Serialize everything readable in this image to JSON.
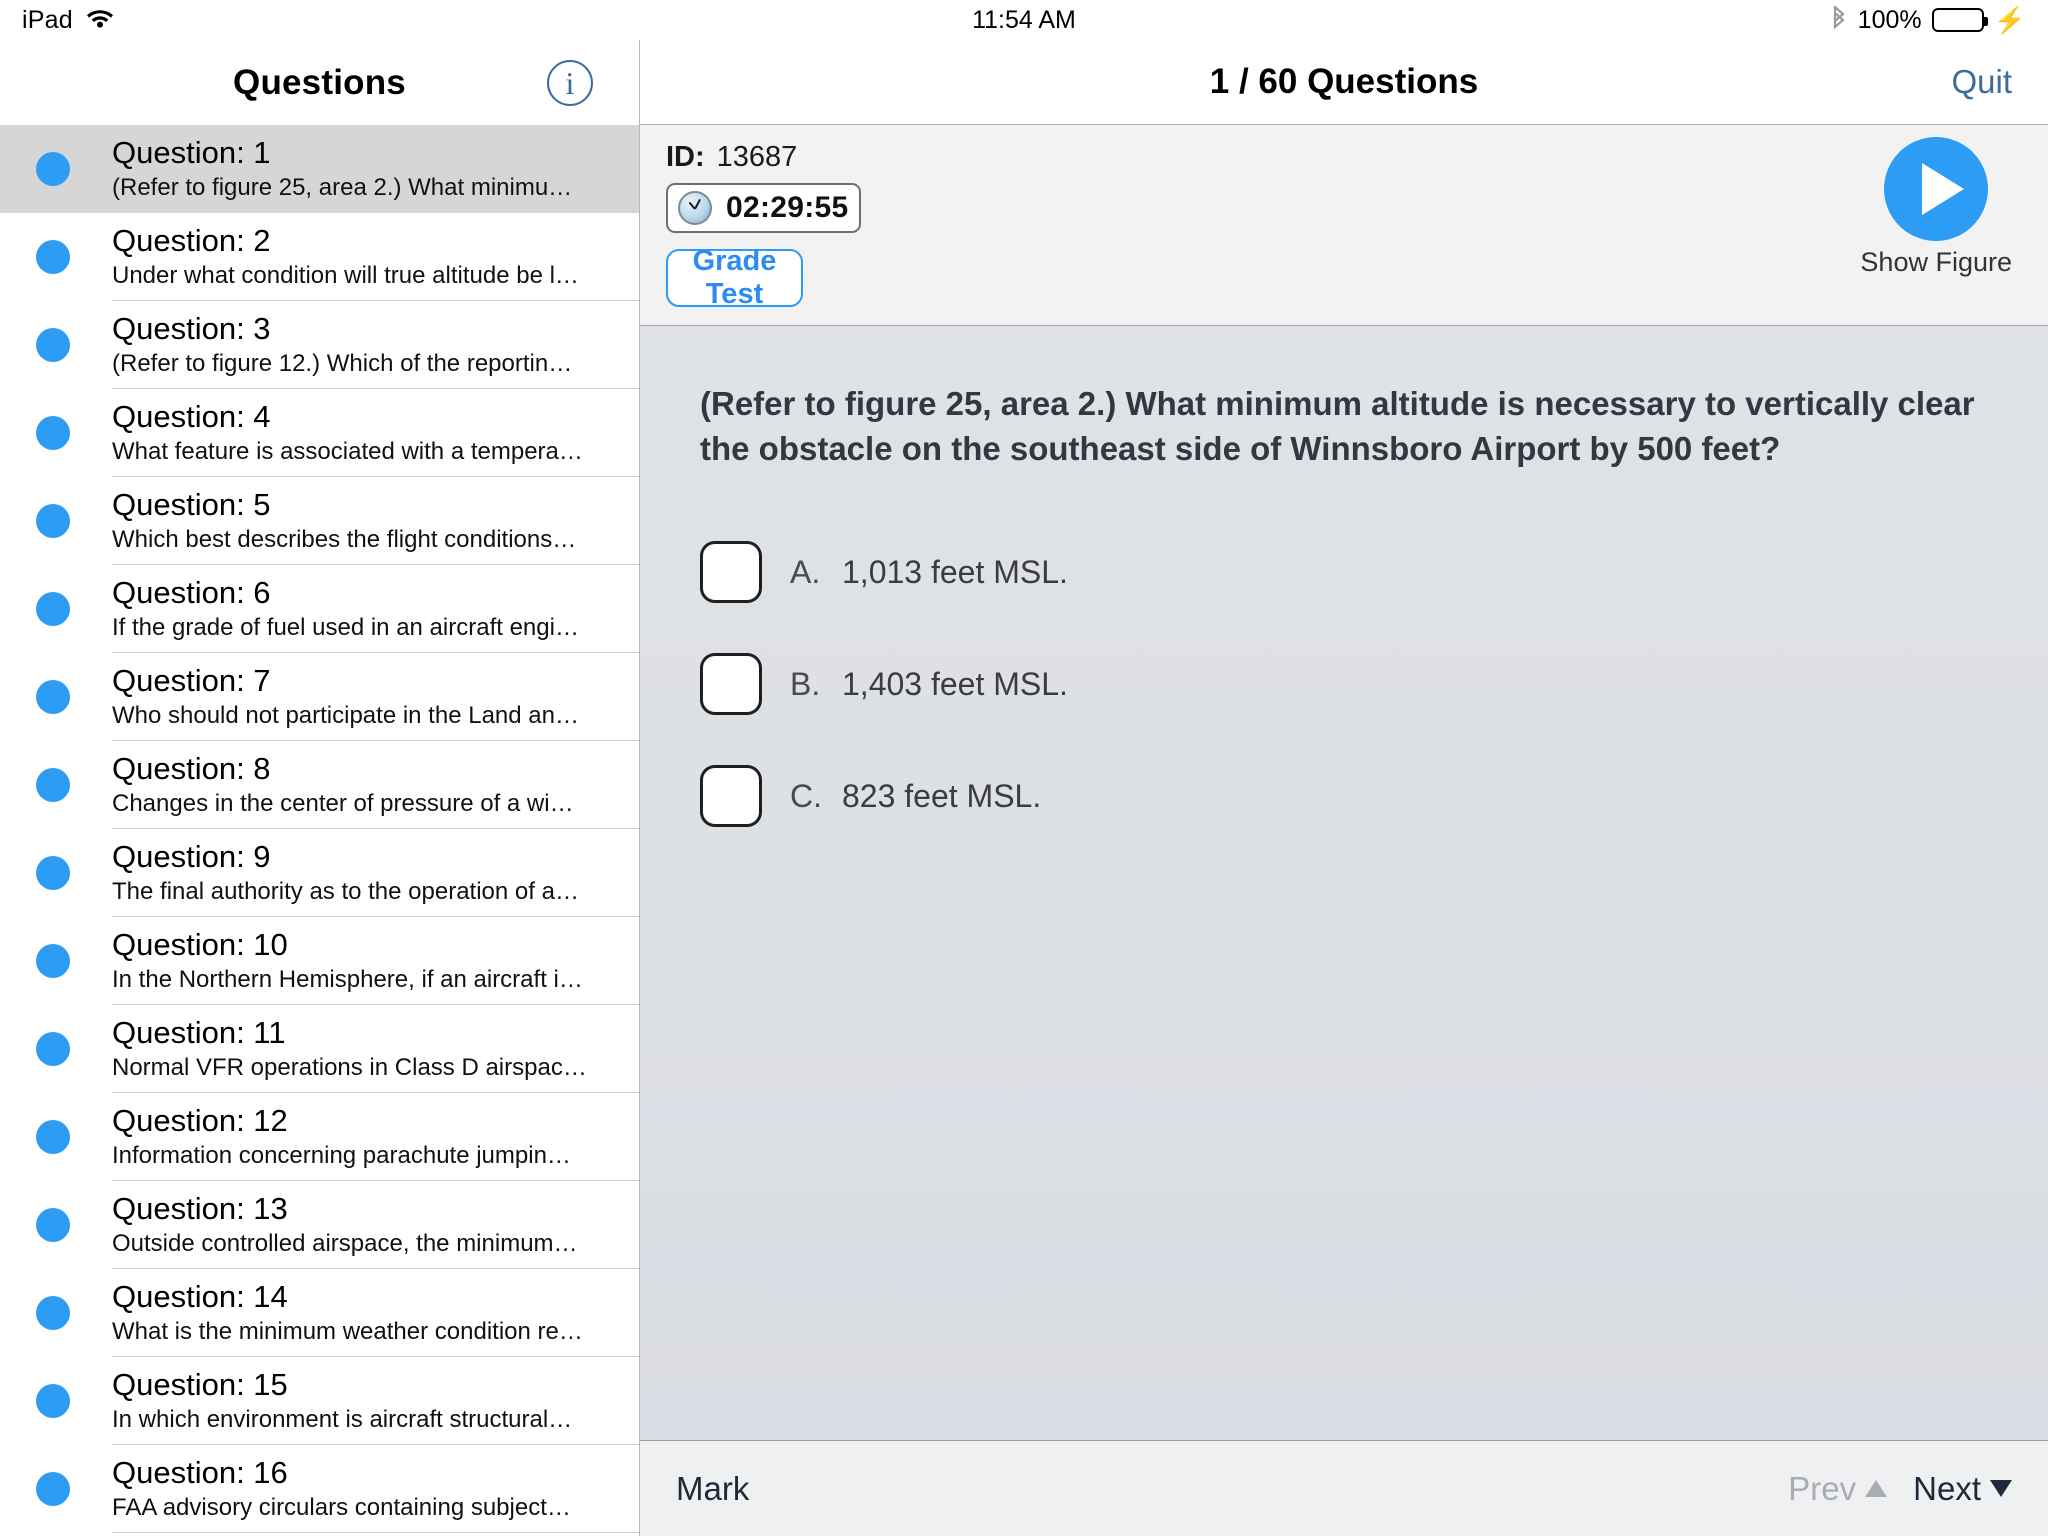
{
  "status_bar": {
    "device": "iPad",
    "wifi_icon": "wifi-icon",
    "time": "11:54 AM",
    "bluetooth_icon": "bluetooth-icon",
    "battery_percent": "100%",
    "charging_icon": "lightning-bolt-icon"
  },
  "sidebar": {
    "title": "Questions",
    "info_icon": "i",
    "questions": [
      {
        "title": "Question: 1",
        "preview": "(Refer to figure 25, area 2.) What minimu…",
        "selected": true
      },
      {
        "title": "Question: 2",
        "preview": "Under what condition will true altitude be l…",
        "selected": false
      },
      {
        "title": "Question: 3",
        "preview": "(Refer to figure 12.) Which of the reportin…",
        "selected": false
      },
      {
        "title": "Question: 4",
        "preview": "What feature is associated with a tempera…",
        "selected": false
      },
      {
        "title": "Question: 5",
        "preview": "Which best describes the flight conditions…",
        "selected": false
      },
      {
        "title": "Question: 6",
        "preview": "If the grade of fuel used in an aircraft engi…",
        "selected": false
      },
      {
        "title": "Question: 7",
        "preview": "Who should not participate in the Land an…",
        "selected": false
      },
      {
        "title": "Question: 8",
        "preview": "Changes in the center of pressure of a wi…",
        "selected": false
      },
      {
        "title": "Question: 9",
        "preview": "The final authority as to the operation of a…",
        "selected": false
      },
      {
        "title": "Question: 10",
        "preview": "In the Northern Hemisphere, if an aircraft i…",
        "selected": false
      },
      {
        "title": "Question: 11",
        "preview": "Normal VFR operations in Class D airspac…",
        "selected": false
      },
      {
        "title": "Question: 12",
        "preview": "Information concerning parachute jumpin…",
        "selected": false
      },
      {
        "title": "Question: 13",
        "preview": "Outside controlled airspace, the minimum…",
        "selected": false
      },
      {
        "title": "Question: 14",
        "preview": "What is the minimum weather condition re…",
        "selected": false
      },
      {
        "title": "Question: 15",
        "preview": "In which environment is aircraft structural…",
        "selected": false
      },
      {
        "title": "Question: 16",
        "preview": "FAA advisory circulars containing subject…",
        "selected": false
      }
    ]
  },
  "content_header": {
    "title": "1 / 60 Questions",
    "quit_label": "Quit"
  },
  "info_panel": {
    "id_label": "ID:",
    "id_value": "13687",
    "clock_icon": "clock-icon",
    "timer": "02:29:55",
    "grade_test_label": "Grade Test",
    "show_figure_label": "Show Figure",
    "play_icon": "play-icon"
  },
  "question": {
    "text": "(Refer to figure 25, area 2.) What minimum altitude is necessary to vertically clear the obstacle on the southeast side of Winnsboro Airport by 500 feet?",
    "answers": [
      {
        "letter": "A.",
        "label": "1,013 feet MSL.",
        "checked": false
      },
      {
        "letter": "B.",
        "label": "1,403 feet MSL.",
        "checked": false
      },
      {
        "letter": "C.",
        "label": "823 feet MSL.",
        "checked": false
      }
    ]
  },
  "bottom_bar": {
    "mark_label": "Mark",
    "prev_label": "Prev",
    "next_label": "Next"
  },
  "colors": {
    "accent_blue": "#2d9cf5",
    "link_blue": "#3b6c9b",
    "battery_green": "#4CD964",
    "selected_row": "#d6d6d6",
    "content_bg": "#dee1e6"
  }
}
